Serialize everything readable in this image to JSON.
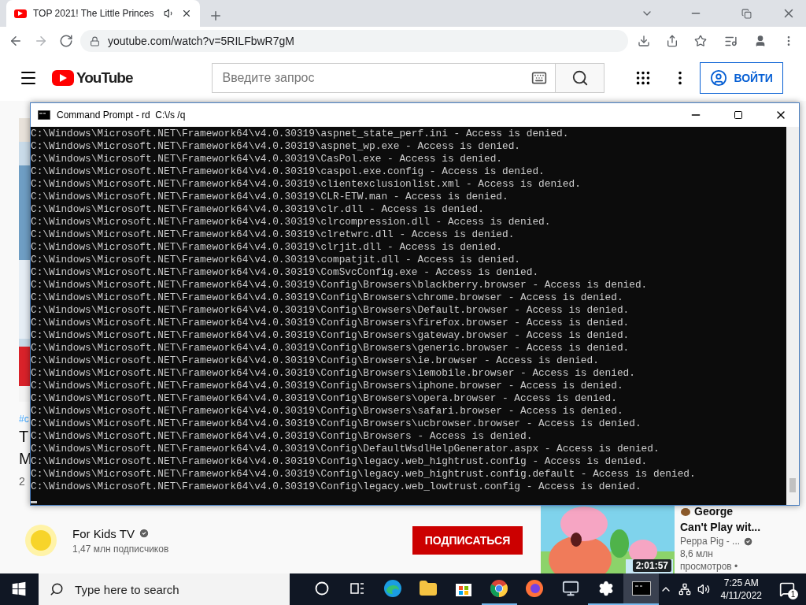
{
  "browser": {
    "tab": {
      "title": "TOP 2021! The Little Princes",
      "audio": true
    },
    "nav": [
      {
        "kind": "back",
        "disabled": false
      },
      {
        "kind": "forward",
        "disabled": true
      },
      {
        "kind": "reload",
        "disabled": false
      }
    ],
    "url": "youtube.com/watch?v=5RILFbwR7gM"
  },
  "youtube": {
    "logo": "YouTube",
    "search": {
      "placeholder": "Введите запрос"
    },
    "signin": "ВОЙТИ",
    "video_fragments": [
      "#c",
      "T",
      "M",
      "2"
    ],
    "channel": {
      "name": "For Kids TV",
      "verified": true,
      "subscribers": "1,47 млн подписчиков",
      "subscribe": "ПОДПИСАТЬСЯ"
    },
    "related": {
      "title_line_1": "George",
      "title_line_2": "Can't Play wit...",
      "channel": "Peppa Pig - ...",
      "verified": true,
      "views": "8,6 млн",
      "views_2": "просмотров •",
      "duration": "2:01:57"
    }
  },
  "cmd": {
    "title": "Command Prompt - rd  C:\\/s /q",
    "lines": [
      "C:\\Windows\\Microsoft.NET\\Framework64\\v4.0.30319\\aspnet_state_perf.ini - Access is denied.",
      "C:\\Windows\\Microsoft.NET\\Framework64\\v4.0.30319\\aspnet_wp.exe - Access is denied.",
      "C:\\Windows\\Microsoft.NET\\Framework64\\v4.0.30319\\CasPol.exe - Access is denied.",
      "C:\\Windows\\Microsoft.NET\\Framework64\\v4.0.30319\\caspol.exe.config - Access is denied.",
      "C:\\Windows\\Microsoft.NET\\Framework64\\v4.0.30319\\clientexclusionlist.xml - Access is denied.",
      "C:\\Windows\\Microsoft.NET\\Framework64\\v4.0.30319\\CLR-ETW.man - Access is denied.",
      "C:\\Windows\\Microsoft.NET\\Framework64\\v4.0.30319\\clr.dll - Access is denied.",
      "C:\\Windows\\Microsoft.NET\\Framework64\\v4.0.30319\\clrcompression.dll - Access is denied.",
      "C:\\Windows\\Microsoft.NET\\Framework64\\v4.0.30319\\clretwrc.dll - Access is denied.",
      "C:\\Windows\\Microsoft.NET\\Framework64\\v4.0.30319\\clrjit.dll - Access is denied.",
      "C:\\Windows\\Microsoft.NET\\Framework64\\v4.0.30319\\compatjit.dll - Access is denied.",
      "C:\\Windows\\Microsoft.NET\\Framework64\\v4.0.30319\\ComSvcConfig.exe - Access is denied.",
      "C:\\Windows\\Microsoft.NET\\Framework64\\v4.0.30319\\Config\\Browsers\\blackberry.browser - Access is denied.",
      "C:\\Windows\\Microsoft.NET\\Framework64\\v4.0.30319\\Config\\Browsers\\chrome.browser - Access is denied.",
      "C:\\Windows\\Microsoft.NET\\Framework64\\v4.0.30319\\Config\\Browsers\\Default.browser - Access is denied.",
      "C:\\Windows\\Microsoft.NET\\Framework64\\v4.0.30319\\Config\\Browsers\\firefox.browser - Access is denied.",
      "C:\\Windows\\Microsoft.NET\\Framework64\\v4.0.30319\\Config\\Browsers\\gateway.browser - Access is denied.",
      "C:\\Windows\\Microsoft.NET\\Framework64\\v4.0.30319\\Config\\Browsers\\generic.browser - Access is denied.",
      "C:\\Windows\\Microsoft.NET\\Framework64\\v4.0.30319\\Config\\Browsers\\ie.browser - Access is denied.",
      "C:\\Windows\\Microsoft.NET\\Framework64\\v4.0.30319\\Config\\Browsers\\iemobile.browser - Access is denied.",
      "C:\\Windows\\Microsoft.NET\\Framework64\\v4.0.30319\\Config\\Browsers\\iphone.browser - Access is denied.",
      "C:\\Windows\\Microsoft.NET\\Framework64\\v4.0.30319\\Config\\Browsers\\opera.browser - Access is denied.",
      "C:\\Windows\\Microsoft.NET\\Framework64\\v4.0.30319\\Config\\Browsers\\safari.browser - Access is denied.",
      "C:\\Windows\\Microsoft.NET\\Framework64\\v4.0.30319\\Config\\Browsers\\ucbrowser.browser - Access is denied.",
      "C:\\Windows\\Microsoft.NET\\Framework64\\v4.0.30319\\Config\\Browsers - Access is denied.",
      "C:\\Windows\\Microsoft.NET\\Framework64\\v4.0.30319\\Config\\DefaultWsdlHelpGenerator.aspx - Access is denied.",
      "C:\\Windows\\Microsoft.NET\\Framework64\\v4.0.30319\\Config\\legacy.web_hightrust.config - Access is denied.",
      "C:\\Windows\\Microsoft.NET\\Framework64\\v4.0.30319\\Config\\legacy.web_hightrust.config.default - Access is denied.",
      "C:\\Windows\\Microsoft.NET\\Framework64\\v4.0.30319\\Config\\legacy.web_lowtrust.config - Access is denied."
    ]
  },
  "taskbar": {
    "search": {
      "placeholder": "Type here to search"
    },
    "apps": [
      {
        "kind": "cortana",
        "open": false,
        "active": false
      },
      {
        "kind": "taskview",
        "open": false,
        "active": false
      },
      {
        "kind": "edge",
        "open": false,
        "active": false
      },
      {
        "kind": "explorer",
        "open": false,
        "active": false
      },
      {
        "kind": "store",
        "open": false,
        "active": false
      },
      {
        "kind": "chrome",
        "open": true,
        "active": false
      },
      {
        "kind": "firefox",
        "open": false,
        "active": false
      },
      {
        "kind": "monitor",
        "open": false,
        "active": false
      },
      {
        "kind": "settings",
        "open": true,
        "active": false
      },
      {
        "kind": "terminal",
        "open": true,
        "active": true
      }
    ],
    "time": "7:25 AM",
    "date": "4/11/2022",
    "notifications": "1"
  }
}
